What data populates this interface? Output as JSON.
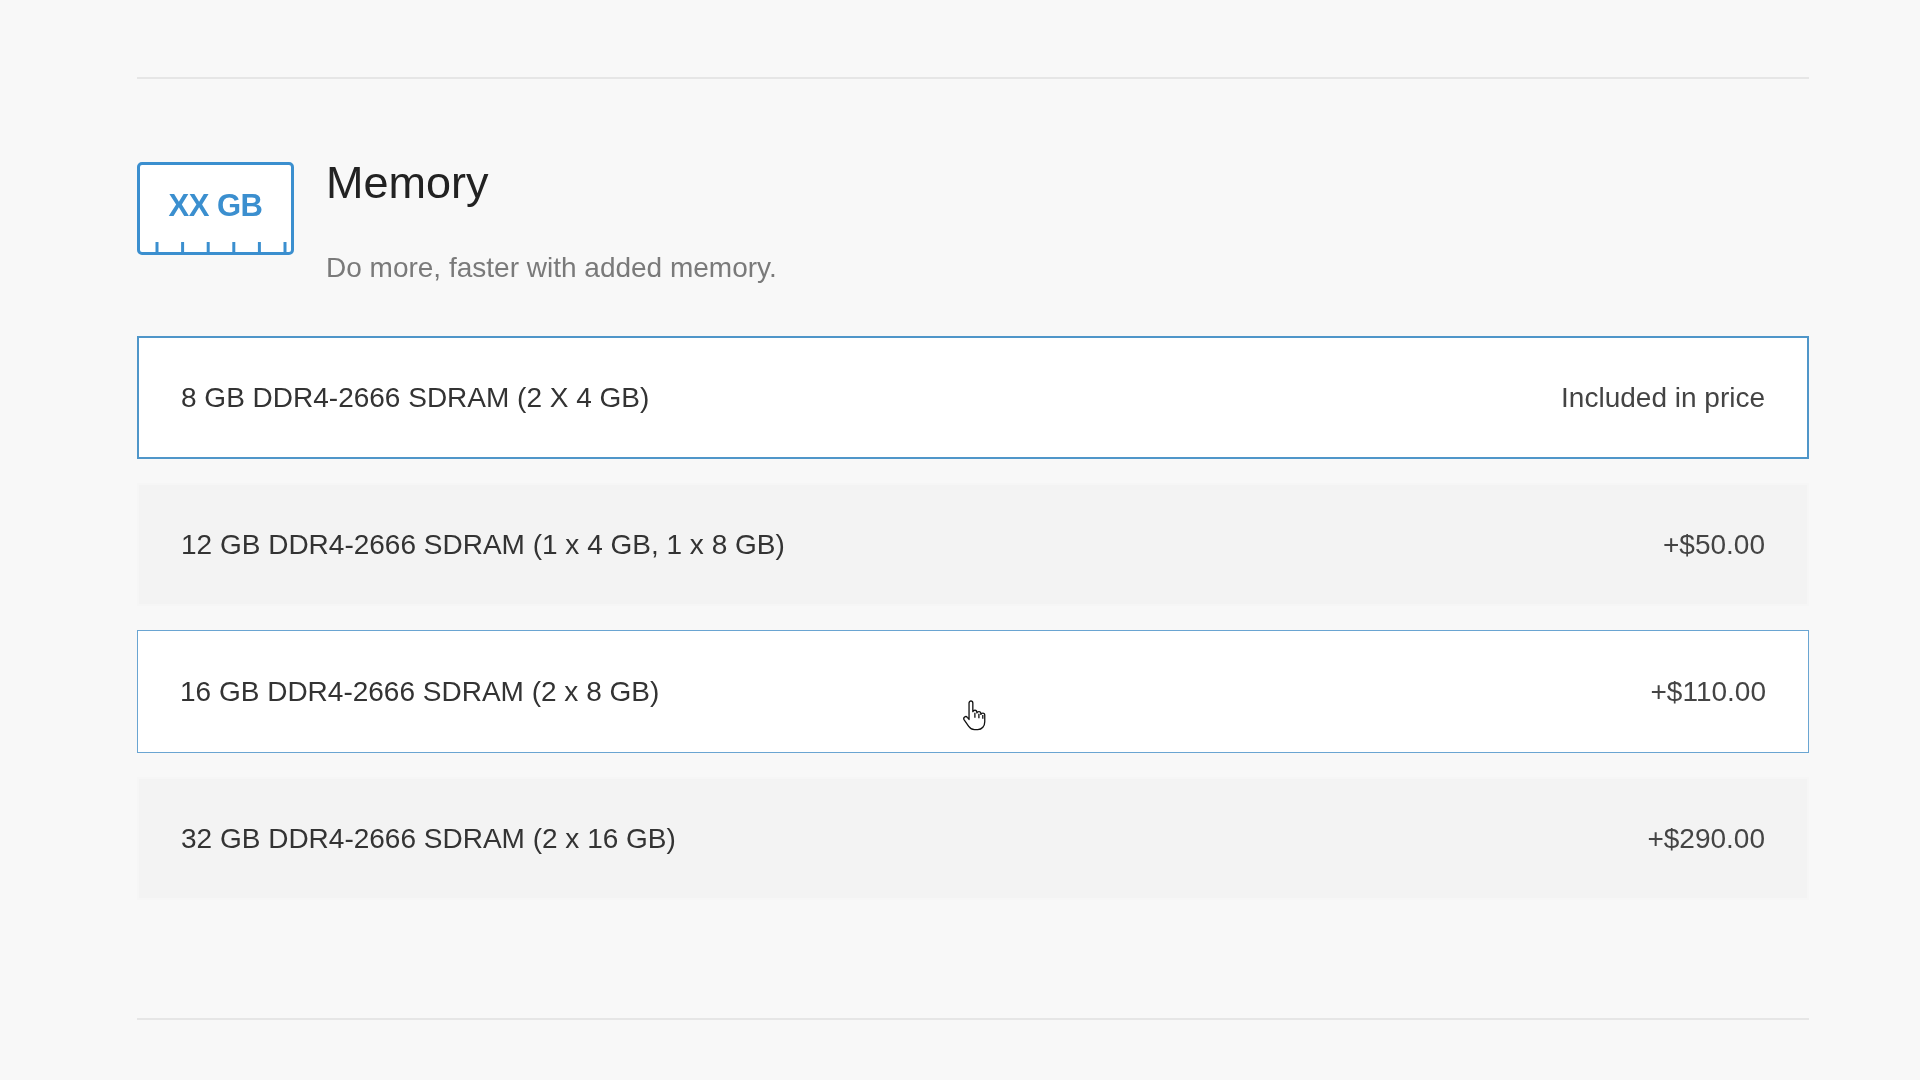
{
  "section": {
    "icon_label": "XX GB",
    "title": "Memory",
    "subtitle": "Do more, faster with added memory."
  },
  "options": [
    {
      "label": "8 GB DDR4-2666 SDRAM (2 X 4 GB)",
      "price": "Included in price",
      "selected": true,
      "hovered": false
    },
    {
      "label": "12 GB DDR4-2666 SDRAM (1 x 4 GB, 1 x 8 GB)",
      "price": "+$50.00",
      "selected": false,
      "hovered": false
    },
    {
      "label": "16 GB DDR4-2666 SDRAM (2 x 8 GB)",
      "price": "+$110.00",
      "selected": false,
      "hovered": true
    },
    {
      "label": "32 GB DDR4-2666 SDRAM (2 x 16 GB)",
      "price": "+$290.00",
      "selected": false,
      "hovered": false
    }
  ]
}
